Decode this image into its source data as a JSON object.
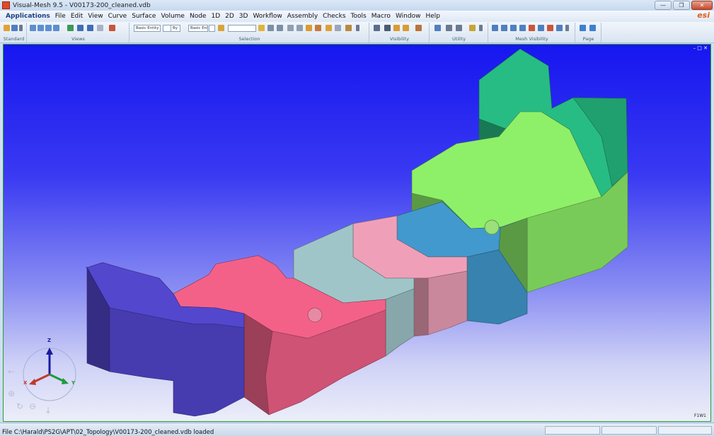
{
  "window": {
    "title": "Visual-Mesh 9.5 - V00173-200_cleaned.vdb",
    "minimize": "—",
    "maximize": "❐",
    "close": "✕"
  },
  "brand": "esi",
  "menu": [
    "Applications",
    "File",
    "Edit",
    "View",
    "Curve",
    "Surface",
    "Volume",
    "Node",
    "1D",
    "2D",
    "3D",
    "Workflow",
    "Assembly",
    "Checks",
    "Tools",
    "Macro",
    "Window",
    "Help"
  ],
  "toolbar": {
    "groups": [
      "Standard",
      "Views",
      "Selection",
      "Visibility",
      "Utility",
      "Mesh Visibility",
      "Page"
    ],
    "entity_combo": "Basic Entity",
    "by_combo": "By",
    "entity_combo_2": "Basic Ent"
  },
  "viewport": {
    "controls": "– □ ✕",
    "frame_label": "F1W1",
    "axes": {
      "z": "Z",
      "x": "X",
      "y": "Y"
    },
    "part_colors": [
      "#4a3fb8",
      "#d9577a",
      "#8fb0b3",
      "#d58fa4",
      "#3a89b8",
      "#7fd65e",
      "#23a875"
    ]
  },
  "status": {
    "message": "File C:\\Harald\\PS2G\\APT\\02_Topology\\V00173-200_cleaned.vdb loaded"
  }
}
